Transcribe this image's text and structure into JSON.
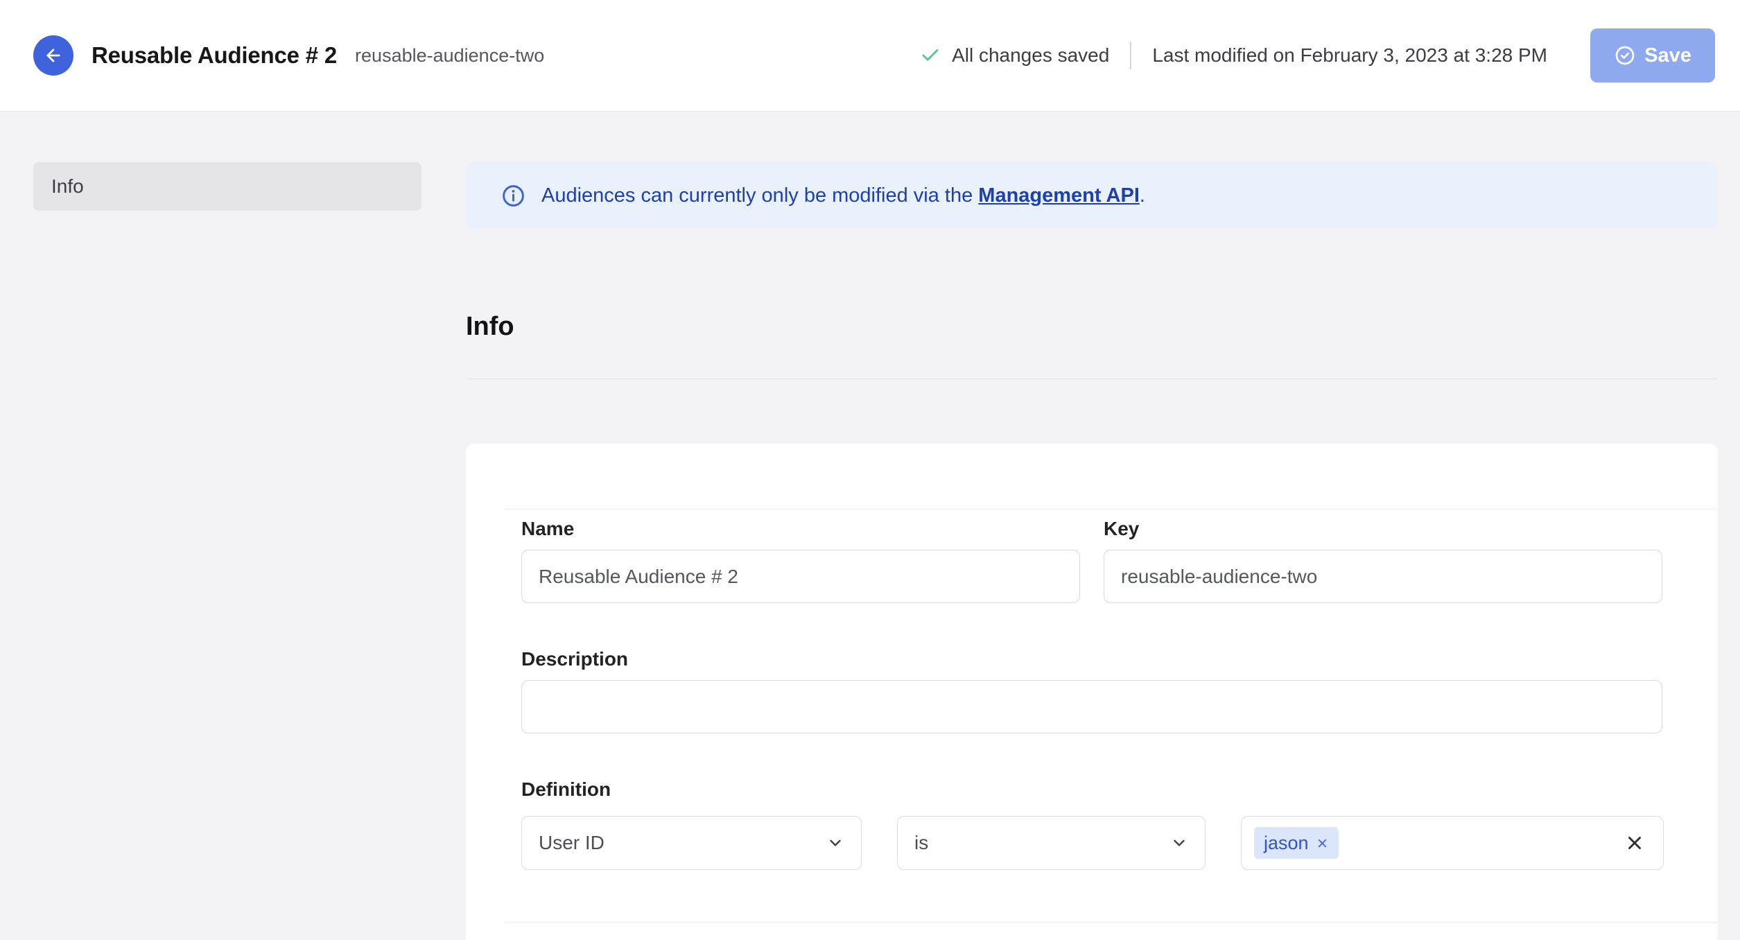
{
  "header": {
    "title": "Reusable Audience # 2",
    "slug": "reusable-audience-two",
    "status": "All changes saved",
    "last_modified": "Last modified on February 3, 2023 at 3:28 PM",
    "save_label": "Save"
  },
  "sidebar": {
    "items": [
      {
        "label": "Info",
        "active": true
      }
    ]
  },
  "banner": {
    "text_before": "Audiences can currently only be modified via the ",
    "link_text": "Management API",
    "text_after": "."
  },
  "section": {
    "title": "Info"
  },
  "form": {
    "name": {
      "label": "Name",
      "value": "Reusable Audience # 2"
    },
    "key": {
      "label": "Key",
      "value": "reusable-audience-two"
    },
    "description": {
      "label": "Description",
      "value": ""
    },
    "definition": {
      "label": "Definition",
      "field_selected": "User ID",
      "operator_selected": "is",
      "tags": [
        {
          "label": "jason"
        }
      ]
    }
  },
  "icons": {
    "back": "arrow-left",
    "saved_status": "check",
    "save_button": "check-circle",
    "banner": "info-circle",
    "dropdown": "chevron-down",
    "tag_remove": "x",
    "clear_values": "x"
  },
  "colors": {
    "accent_blue": "#3e63dd",
    "save_button_bg": "#8ea9ee",
    "success_green": "#5bc791",
    "banner_bg": "#e9f1fc",
    "banner_text": "#1e40af",
    "tag_bg": "#dbe6fb",
    "tag_text": "#3154cc",
    "page_bg": "#f3f3f5"
  }
}
